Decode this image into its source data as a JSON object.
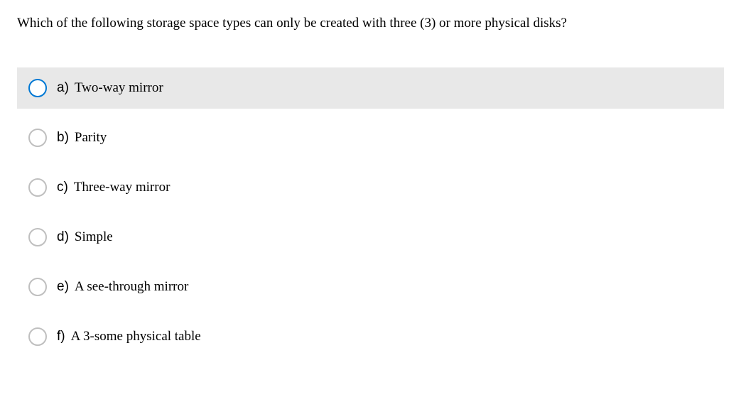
{
  "question": "Which of the following storage space types can only be created with three (3) or more physical disks?",
  "options": [
    {
      "letter": "a)",
      "text": "Two-way mirror",
      "highlighted": true
    },
    {
      "letter": "b)",
      "text": "Parity",
      "highlighted": false
    },
    {
      "letter": "c)",
      "text": "Three-way mirror",
      "highlighted": false
    },
    {
      "letter": "d)",
      "text": "Simple",
      "highlighted": false
    },
    {
      "letter": "e)",
      "text": "A see-through mirror",
      "highlighted": false
    },
    {
      "letter": "f)",
      "text": "A 3-some physical table",
      "highlighted": false
    }
  ]
}
